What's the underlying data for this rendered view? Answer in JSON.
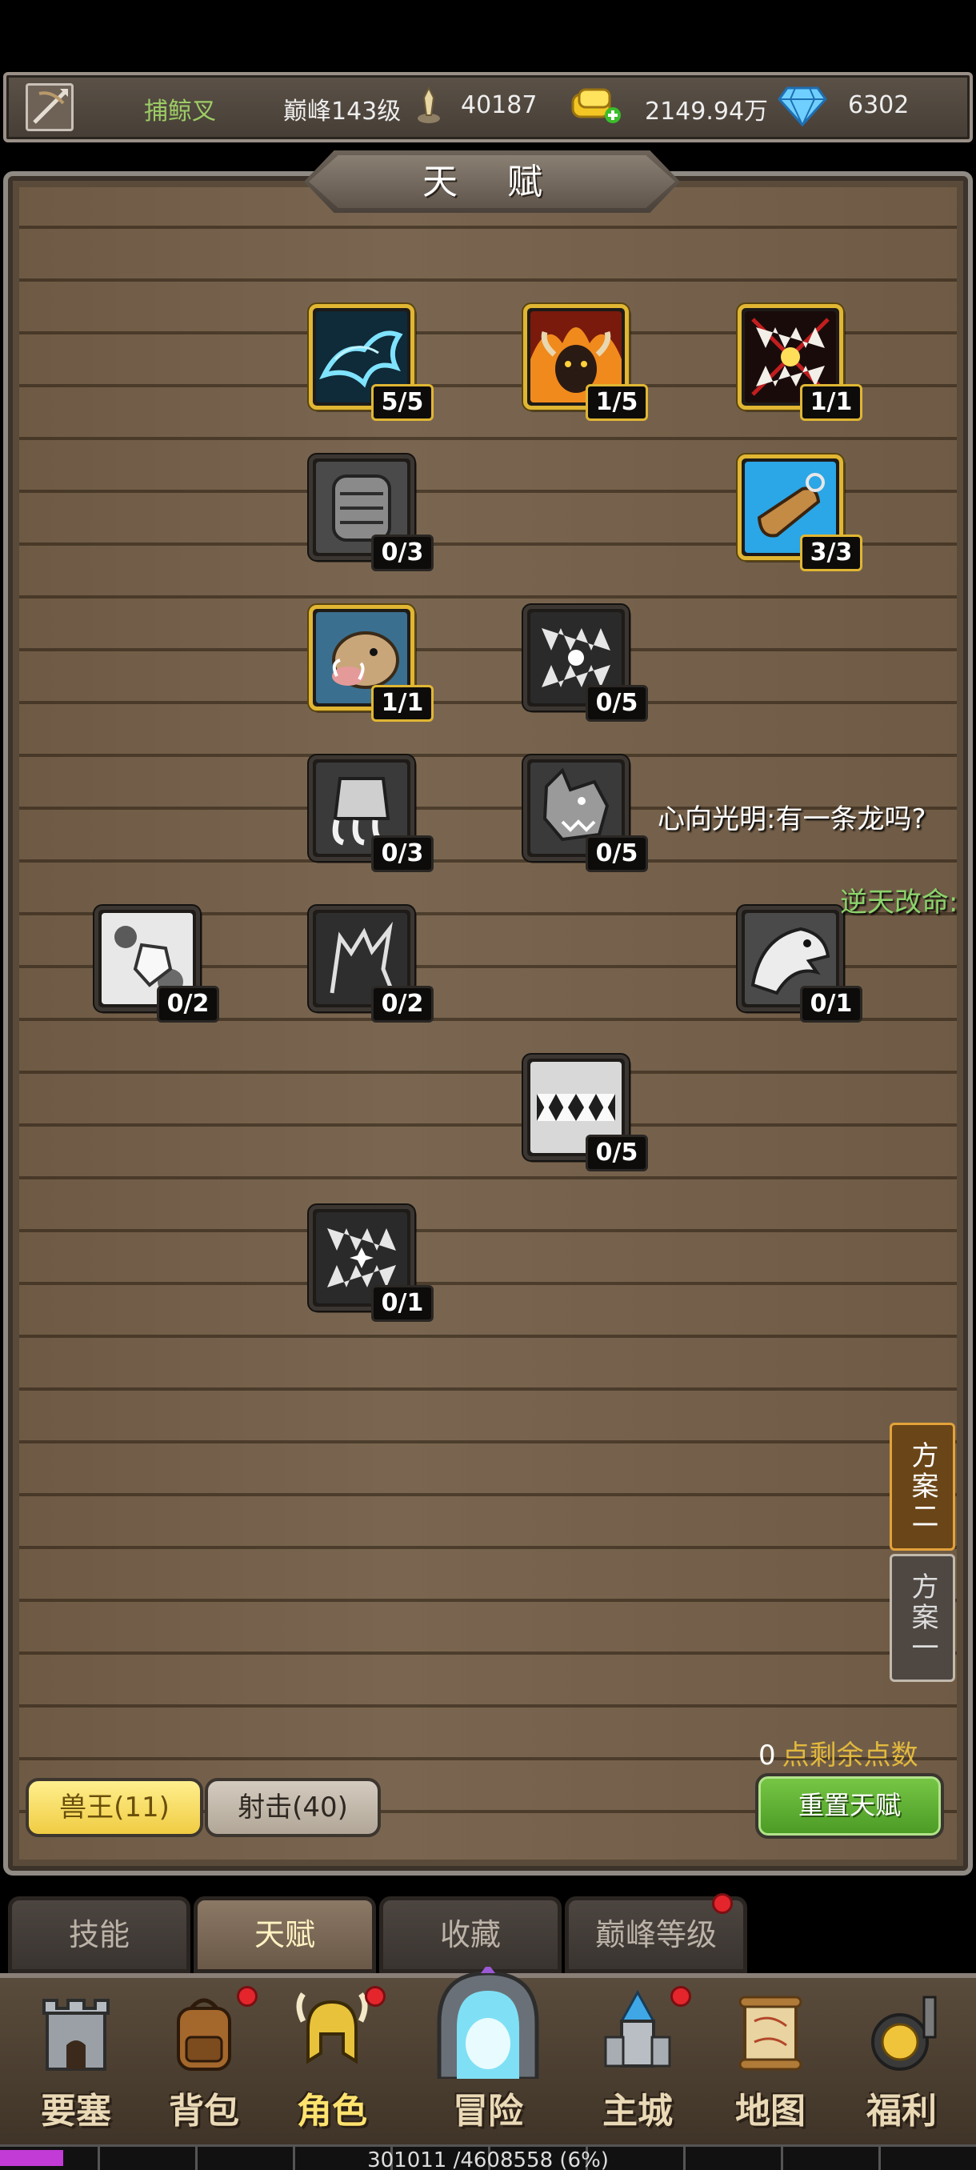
{
  "header": {
    "player_name": "捕鲸叉",
    "peak_level": "巅峰143级",
    "combat_power": "40187",
    "gold": "2149.94万",
    "gems": "6302",
    "icons": [
      "crossbow-icon",
      "peak-sword-icon",
      "gold-coins-icon",
      "diamond-icon"
    ]
  },
  "panel": {
    "title": "天 赋"
  },
  "talents": [
    {
      "name": "spirit-wolf-talent",
      "level": "5/5",
      "active": true
    },
    {
      "name": "flame-bull-talent",
      "level": "1/5",
      "active": true
    },
    {
      "name": "blood-fang-talent",
      "level": "1/1",
      "active": true
    },
    {
      "name": "claw-armor-talent",
      "level": "0/3",
      "active": false
    },
    {
      "name": "hunting-whistle-talent",
      "level": "3/3",
      "active": true
    },
    {
      "name": "boar-talent",
      "level": "1/1",
      "active": true
    },
    {
      "name": "fang-burst-talent",
      "level": "0/5",
      "active": false
    },
    {
      "name": "tiger-claw-talent",
      "level": "0/3",
      "active": false
    },
    {
      "name": "werewolf-talent",
      "level": "0/5",
      "active": false
    },
    {
      "name": "paw-print-talent",
      "level": "0/2",
      "active": false
    },
    {
      "name": "shadow-cat-talent",
      "level": "0/2",
      "active": false
    },
    {
      "name": "eagle-talent",
      "level": "0/1",
      "active": false
    },
    {
      "name": "jaws-talent",
      "level": "0/5",
      "active": false
    },
    {
      "name": "fang-strike-talent",
      "level": "0/1",
      "active": false
    }
  ],
  "chat": {
    "line1": "心向光明:有一条龙吗?",
    "line2": "逆天改命:"
  },
  "plans": {
    "plan2": "方案二",
    "plan1": "方案一"
  },
  "points": {
    "count": "0",
    "label": "点剩余点数"
  },
  "branches": {
    "beast_king": "兽王(11)",
    "shooting": "射击(40)"
  },
  "reset_label": "重置天赋",
  "subtabs": [
    "技能",
    "天赋",
    "收藏",
    "巅峰等级"
  ],
  "nav": [
    "要塞",
    "背包",
    "角色",
    "冒险",
    "主城",
    "地图",
    "福利"
  ],
  "xp": {
    "text": "301011 /4608558 (6%)",
    "fraction": 0.065
  },
  "colors": {
    "gold_border": "#e0b633",
    "xp_fill": "#c23bd6",
    "reset_green": "#4a9a25"
  }
}
